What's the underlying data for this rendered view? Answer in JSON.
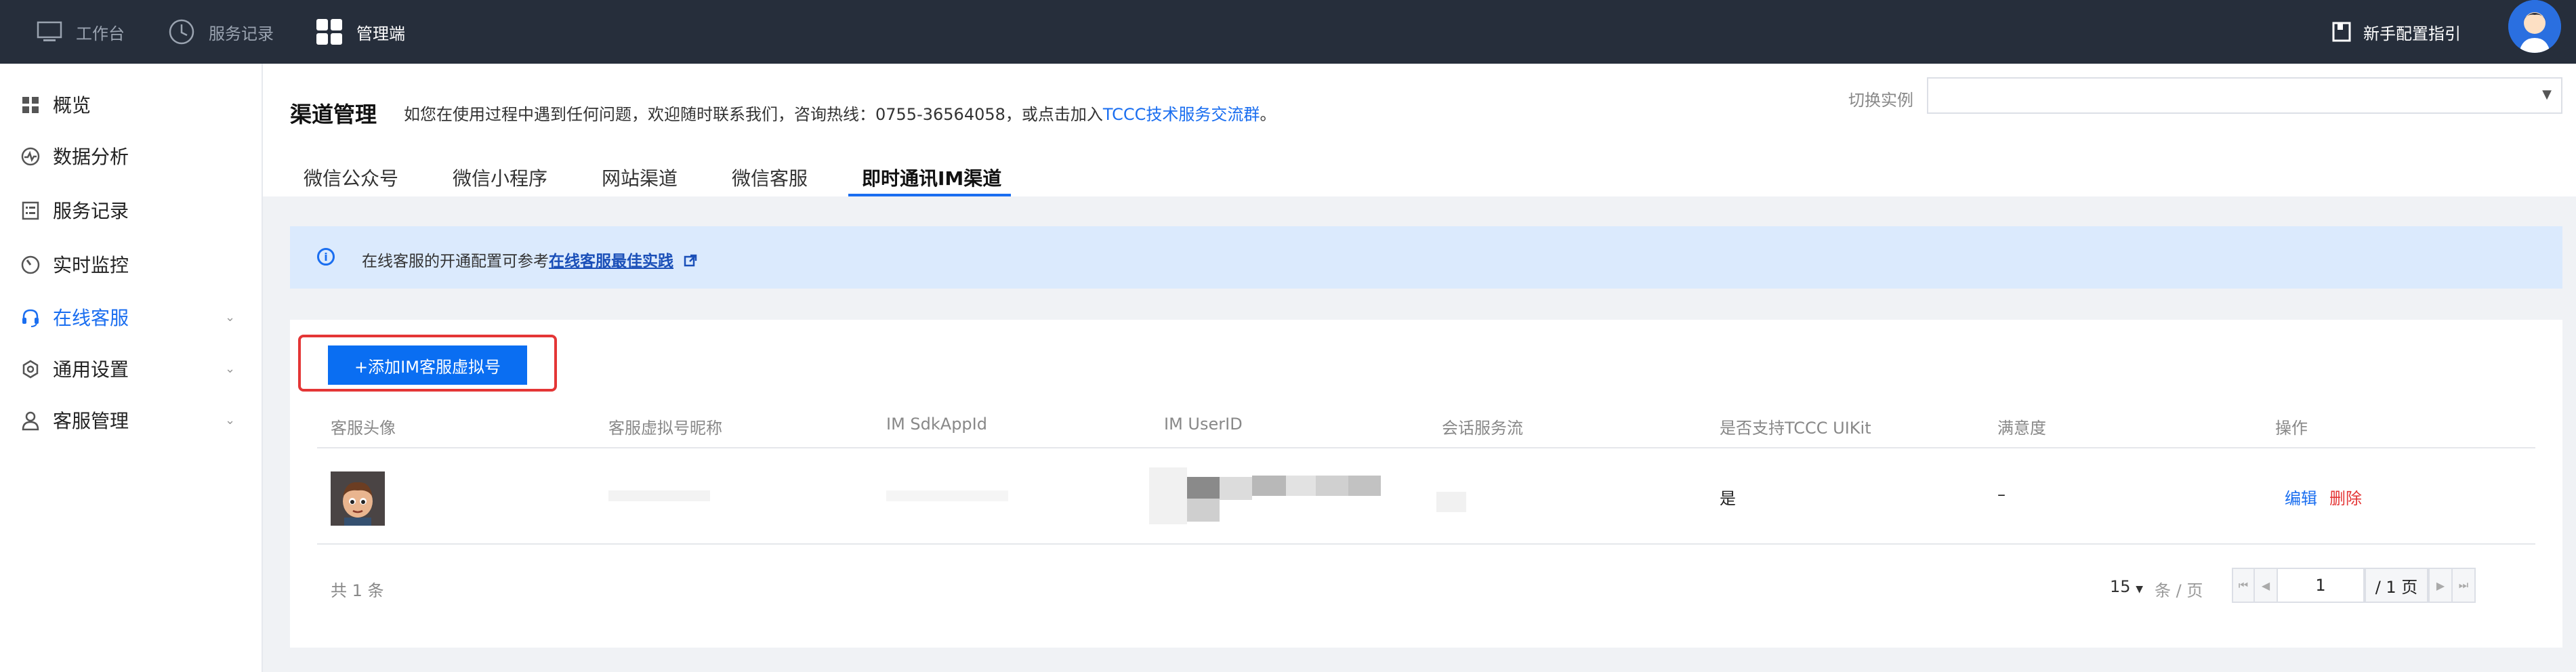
{
  "topbar": {
    "items": [
      {
        "label": "工作台",
        "icon": "monitor-icon"
      },
      {
        "label": "服务记录",
        "icon": "clock-icon"
      },
      {
        "label": "管理端",
        "icon": "grid-icon"
      }
    ],
    "guide_label": "新手配置指引"
  },
  "sidebar": {
    "items": [
      {
        "label": "概览",
        "icon": "dashboard-icon"
      },
      {
        "label": "数据分析",
        "icon": "analytics-icon"
      },
      {
        "label": "服务记录",
        "icon": "list-icon"
      },
      {
        "label": "实时监控",
        "icon": "monitor-gauge-icon"
      },
      {
        "label": "在线客服",
        "icon": "headset-icon",
        "active": true
      },
      {
        "label": "通用设置",
        "icon": "settings-icon"
      },
      {
        "label": "客服管理",
        "icon": "user-icon"
      }
    ]
  },
  "header": {
    "title": "渠道管理",
    "notice": "如您在使用过程中遇到任何问题，欢迎随时联系我们，咨询热线：0755-36564058，或点击加入",
    "notice_link": "TCCC技术服务交流群",
    "notice_end": "。",
    "switch_label": "切换实例",
    "switch_value": ""
  },
  "tabs": [
    "微信公众号",
    "微信小程序",
    "网站渠道",
    "微信客服",
    "即时通讯IM渠道"
  ],
  "info": {
    "text": "在线客服的开通配置可参考",
    "link": "在线客服最佳实践"
  },
  "add_button": "+添加IM客服虚拟号",
  "table": {
    "columns": [
      "客服头像",
      "客服虚拟号昵称",
      "IM SdkAppId",
      "IM UserID",
      "会话服务流",
      "是否支持TCCC UIKit",
      "满意度",
      "操作"
    ],
    "rows": [
      {
        "uikit": "是",
        "satisfaction": "–",
        "edit": "编辑",
        "delete": "删除"
      }
    ]
  },
  "pagination": {
    "total": "共 1 条",
    "page_size": "15",
    "size_unit": "条 / 页",
    "current": "1",
    "total_pages": "/ 1 页"
  },
  "colors": {
    "topbar": "#262e3b",
    "accent": "#1a6ef0",
    "danger": "#e43636",
    "info_bg": "#dbeafd"
  }
}
